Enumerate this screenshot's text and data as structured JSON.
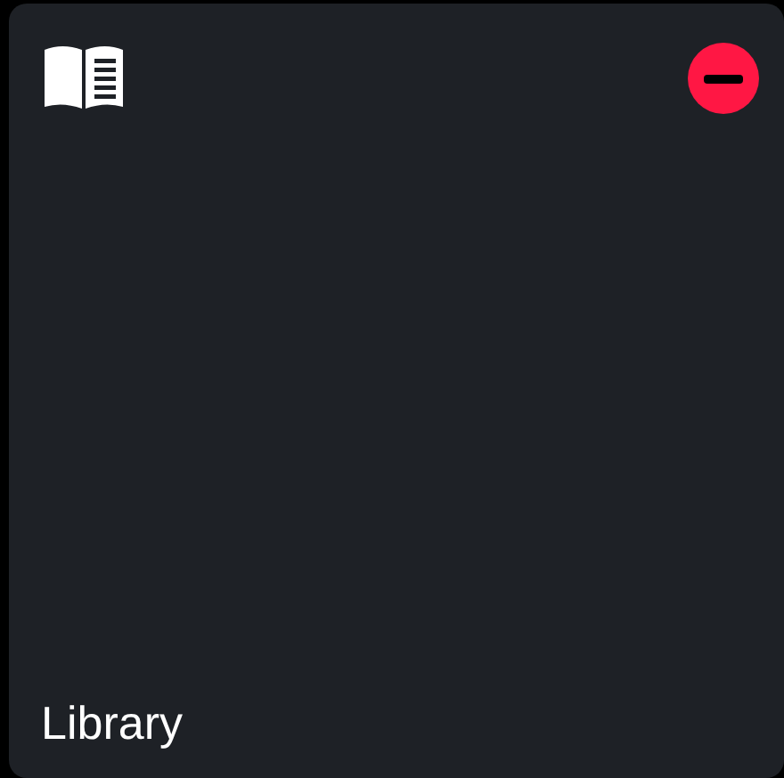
{
  "tile": {
    "label": "Library",
    "removable": true
  }
}
